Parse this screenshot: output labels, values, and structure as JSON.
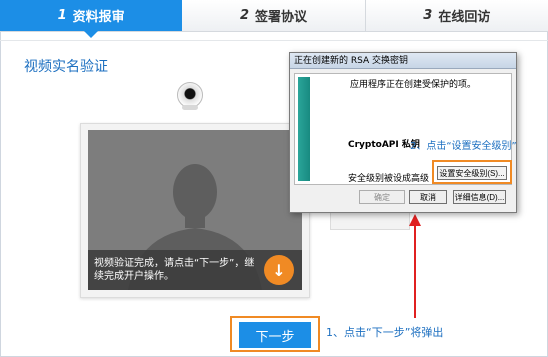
{
  "steps": [
    {
      "num": "1",
      "label": "资料报审"
    },
    {
      "num": "2",
      "label": "签署协议"
    },
    {
      "num": "3",
      "label": "在线回访"
    }
  ],
  "section_title": "视频实名验证",
  "video": {
    "message": "视频验证完成，请点击“下一步”，继续完成开户操作。",
    "down_icon": "↓"
  },
  "next_button": "下一步",
  "note_next": "1、点击“下一步”将弹出",
  "dialog": {
    "title": "正在创建新的 RSA 交换密钥",
    "line1": "应用程序正在创建受保护的项。",
    "caption": "CryptoAPI 私钥",
    "security_text": "安全级别被设成高级",
    "security_button": "设置安全级别(S)...",
    "ok": "确定",
    "cancel": "取消",
    "details": "详细信息(D)..."
  },
  "note_security": "2、点击“设置安全级别”",
  "colors": {
    "accent_blue": "#1c8ee6",
    "highlight_orange": "#f08a24",
    "arrow_red": "#e02020"
  }
}
